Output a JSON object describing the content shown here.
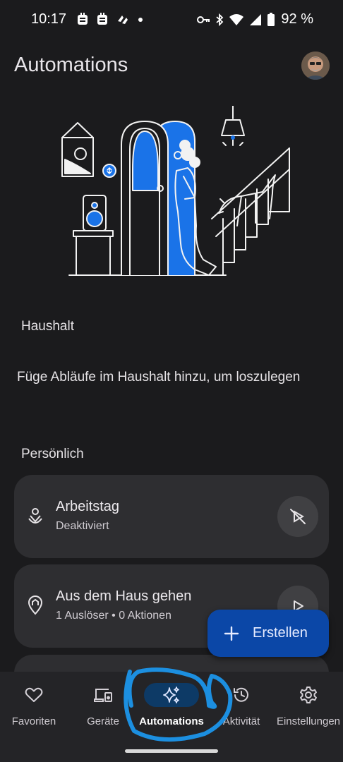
{
  "status_bar": {
    "time": "10:17",
    "battery": "92 %",
    "icons": [
      "notification-app-icon",
      "notification-app-icon",
      "notification-app-icon",
      "dot-icon",
      "vpn-key-icon",
      "bluetooth-icon",
      "wifi-icon",
      "cell-signal-icon",
      "battery-icon"
    ]
  },
  "header": {
    "title": "Automations"
  },
  "sections": {
    "household": {
      "title": "Haushalt",
      "empty_text": "Füge Abläufe im Haushalt hinzu, um loszulegen"
    },
    "personal": {
      "title": "Persönlich"
    }
  },
  "automations": [
    {
      "title": "Arbeitstag",
      "subtitle": "Deaktiviert",
      "icon": "location-person-icon",
      "action_icon": "disabled-play-icon"
    },
    {
      "title": "Aus dem Haus gehen",
      "subtitle": "1 Auslöser • 0 Aktionen",
      "icon": "location-home-icon",
      "action_icon": "play-icon"
    }
  ],
  "fab": {
    "label": "Erstellen",
    "icon": "plus-icon"
  },
  "nav": {
    "items": [
      {
        "label": "Favoriten",
        "icon": "heart-icon"
      },
      {
        "label": "Geräte",
        "icon": "devices-icon"
      },
      {
        "label": "Automations",
        "icon": "sparkle-icon",
        "active": true
      },
      {
        "label": "Aktivität",
        "icon": "history-icon"
      },
      {
        "label": "Einstellungen",
        "icon": "gear-icon"
      }
    ]
  },
  "colors": {
    "background": "#1b1b1d",
    "card": "#2e2e31",
    "accent_blue": "#1a73e8",
    "fab": "#0b47a7",
    "nav_active_pill": "#0d3a66",
    "annotation_scribble": "#1c8fe0"
  }
}
